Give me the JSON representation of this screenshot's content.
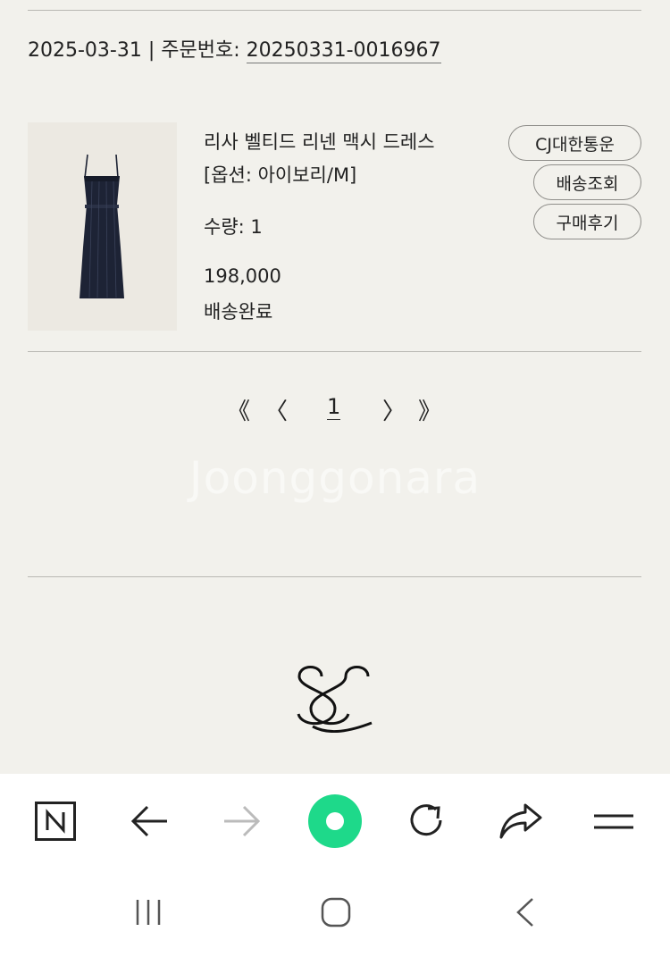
{
  "order": {
    "date": "2025-03-31",
    "separator": " | ",
    "order_no_label": "주문번호: ",
    "order_no": "20250331-0016967"
  },
  "product": {
    "name": "리사 벨티드 리넨 맥시 드레스",
    "option": "[옵션: 아이보리/M]",
    "quantity": "수량: 1",
    "price": "198,000",
    "status": "배송완료"
  },
  "actions": {
    "carrier": "CJ대한통운",
    "track": "배송조회",
    "review": "구매후기"
  },
  "pagination": {
    "first": "《",
    "prev": "〈",
    "current": "1",
    "next": "〉",
    "last": "》"
  },
  "watermark": "Joonggonara",
  "colors": {
    "background": "#f2f1ec",
    "accent_green": "#1ed98a",
    "toolbar_bg": "#ffffff"
  },
  "icons": {
    "toolbar": [
      "naver-n-icon",
      "back-arrow-icon",
      "forward-arrow-icon",
      "green-dot-icon",
      "refresh-icon",
      "share-icon",
      "menu-icon"
    ],
    "system_nav": [
      "recent-apps-icon",
      "home-icon",
      "system-back-icon"
    ]
  }
}
